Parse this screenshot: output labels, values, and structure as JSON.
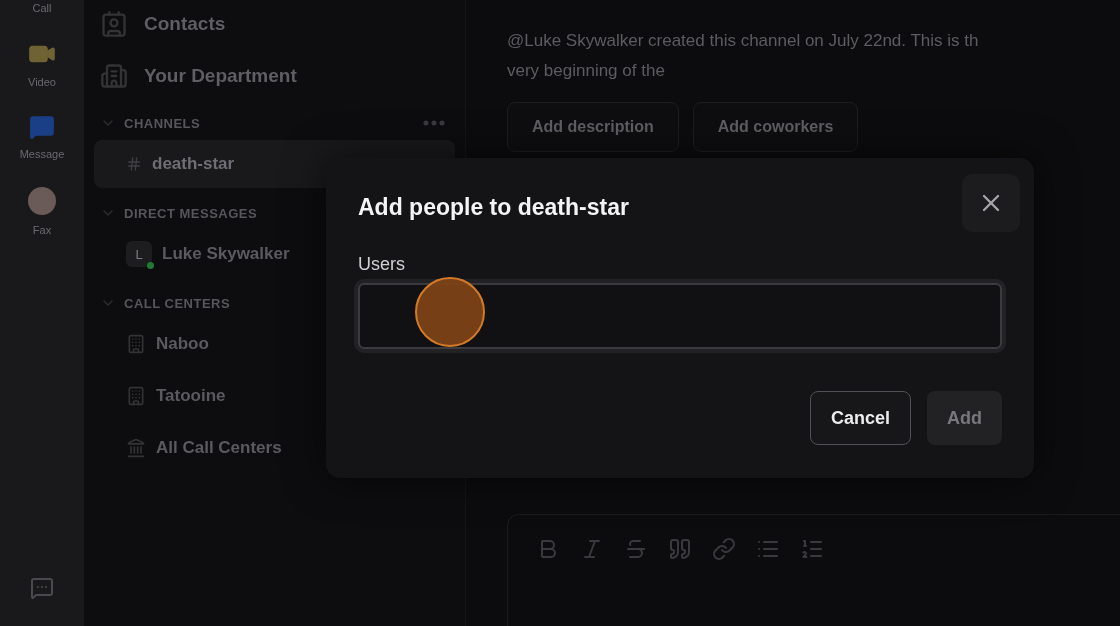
{
  "rail": {
    "items": [
      {
        "label": "Call",
        "kind": "call"
      },
      {
        "label": "Video",
        "kind": "video"
      },
      {
        "label": "Message",
        "kind": "message"
      },
      {
        "label": "Fax",
        "kind": "fax"
      }
    ]
  },
  "sidebar": {
    "links": [
      {
        "label": "Contacts",
        "kind": "contacts"
      },
      {
        "label": "Your Department",
        "kind": "department"
      }
    ],
    "sections": [
      {
        "title": "CHANNELS",
        "expanded": true,
        "items": [
          {
            "label": "death-star",
            "kind": "channel",
            "selected": true
          }
        ]
      },
      {
        "title": "DIRECT MESSAGES",
        "expanded": true,
        "items": [
          {
            "label": "Luke Skywalker",
            "kind": "person",
            "avatar": "L",
            "selected": false
          }
        ]
      },
      {
        "title": "CALL CENTERS",
        "expanded": true,
        "items": [
          {
            "label": "Naboo",
            "kind": "center",
            "selected": false
          },
          {
            "label": "Tatooine",
            "kind": "center",
            "selected": false
          },
          {
            "label": "All Call Centers",
            "kind": "group",
            "selected": false
          }
        ]
      }
    ]
  },
  "channel": {
    "intro": [
      "@Luke Skywalker created this channel on July 22nd. This is th",
      "very beginning of the"
    ],
    "buttons": [
      "Add description",
      "Add coworkers"
    ]
  },
  "dialog": {
    "title": "Add people to death-star",
    "field_label": "Users",
    "buttons": [
      {
        "label": "Cancel",
        "kind": "secondary",
        "disabled": false
      },
      {
        "label": "Add",
        "kind": "primary",
        "disabled": true
      }
    ]
  }
}
